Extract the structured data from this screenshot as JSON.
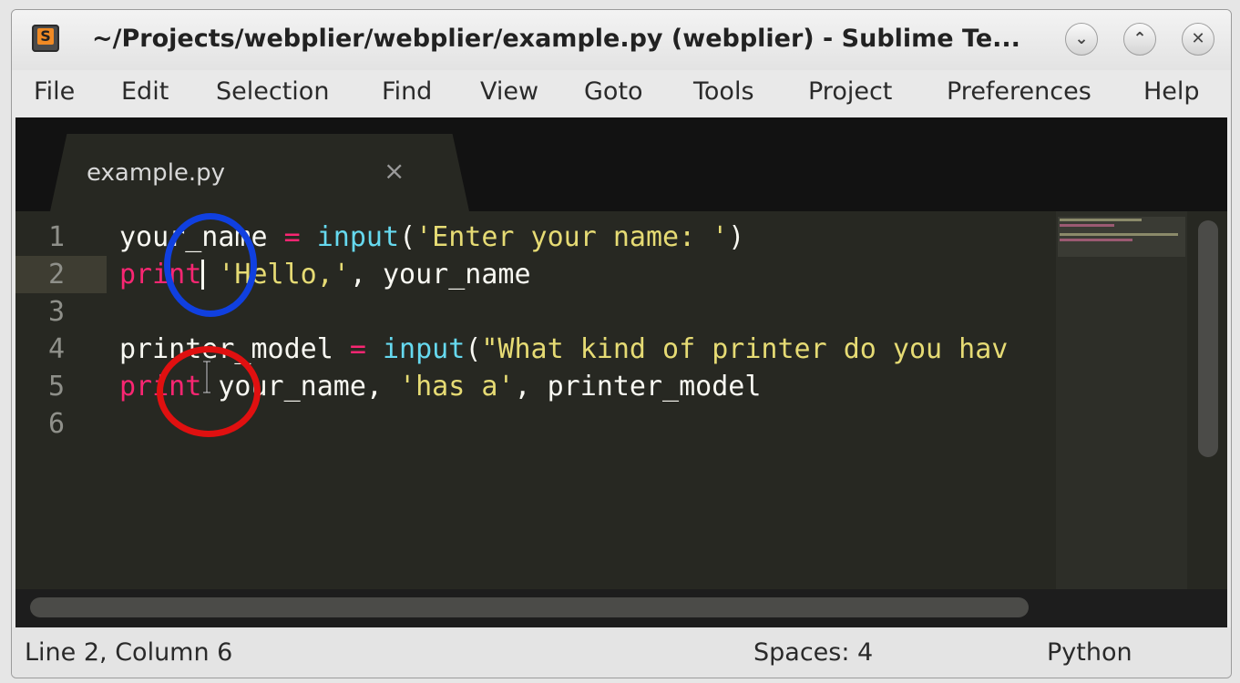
{
  "window": {
    "app_icon": "sublime-text-icon",
    "title": "~/Projects/webplier/webplier/example.py (webplier) - Sublime Te...",
    "buttons": {
      "minimize": "⌄",
      "maximize": "⌃",
      "close": "✕"
    }
  },
  "menu": [
    "File",
    "Edit",
    "Selection",
    "Find",
    "View",
    "Goto",
    "Tools",
    "Project",
    "Preferences",
    "Help"
  ],
  "tab": {
    "label": "example.py",
    "close": "×"
  },
  "lines": [
    {
      "num": "1",
      "tokens": [
        {
          "t": "your_name ",
          "c": "plain"
        },
        {
          "t": "=",
          "c": "kw"
        },
        {
          "t": " ",
          "c": "plain"
        },
        {
          "t": "input",
          "c": "fn"
        },
        {
          "t": "(",
          "c": "plain"
        },
        {
          "t": "'Enter your name: '",
          "c": "str"
        },
        {
          "t": ")",
          "c": "plain"
        }
      ]
    },
    {
      "num": "2",
      "tokens": [
        {
          "t": "print",
          "c": "kw"
        },
        {
          "t": " ",
          "c": "plain"
        },
        {
          "t": "'Hello,'",
          "c": "str"
        },
        {
          "t": ", your_name",
          "c": "plain"
        }
      ]
    },
    {
      "num": "3",
      "tokens": []
    },
    {
      "num": "4",
      "tokens": [
        {
          "t": "printer_model ",
          "c": "plain"
        },
        {
          "t": "=",
          "c": "kw"
        },
        {
          "t": " ",
          "c": "plain"
        },
        {
          "t": "input",
          "c": "fn"
        },
        {
          "t": "(",
          "c": "plain"
        },
        {
          "t": "\"What kind of printer do you hav",
          "c": "str"
        }
      ]
    },
    {
      "num": "5",
      "tokens": [
        {
          "t": "print",
          "c": "kw"
        },
        {
          "t": " your_name, ",
          "c": "plain"
        },
        {
          "t": "'has a'",
          "c": "str"
        },
        {
          "t": ", printer_model",
          "c": "plain"
        }
      ]
    },
    {
      "num": "6",
      "tokens": []
    }
  ],
  "current_line": 2,
  "status": {
    "position": "Line 2, Column 6",
    "indent": "Spaces: 4",
    "syntax": "Python"
  },
  "annotations": {
    "blue_circle_color": "#1040e0",
    "red_circle_color": "#e01010"
  },
  "colors": {
    "keyword": "#f92672",
    "function": "#66d9ef",
    "string": "#e6db74",
    "plain": "#f8f8f2",
    "background": "#272822"
  }
}
